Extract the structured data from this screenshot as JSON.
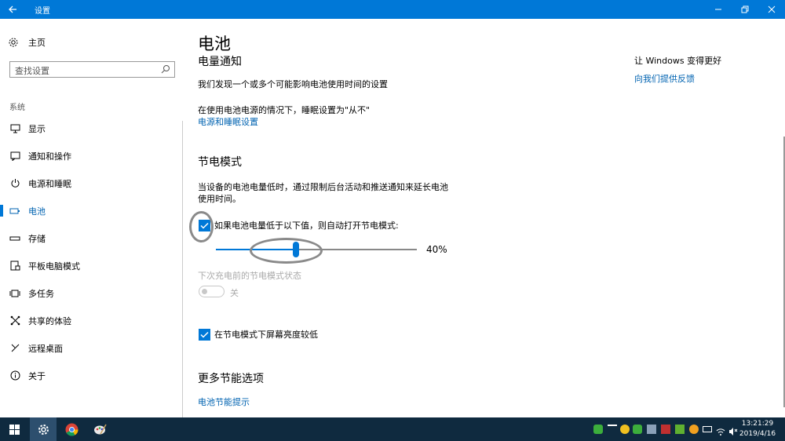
{
  "window": {
    "title": "设置"
  },
  "sidebar": {
    "home_label": "主页",
    "search_placeholder": "查找设置",
    "section_label": "系统",
    "items": [
      {
        "label": "显示",
        "icon": "monitor-icon"
      },
      {
        "label": "通知和操作",
        "icon": "notification-icon"
      },
      {
        "label": "电源和睡眠",
        "icon": "power-icon"
      },
      {
        "label": "电池",
        "icon": "battery-icon",
        "active": true
      },
      {
        "label": "存储",
        "icon": "storage-icon"
      },
      {
        "label": "平板电脑模式",
        "icon": "tablet-icon"
      },
      {
        "label": "多任务",
        "icon": "multitask-icon"
      },
      {
        "label": "共享的体验",
        "icon": "share-icon"
      },
      {
        "label": "远程桌面",
        "icon": "remote-desktop-icon"
      },
      {
        "label": "关于",
        "icon": "info-icon"
      }
    ]
  },
  "main": {
    "title": "电池",
    "notify_heading": "电量通知",
    "notify_text": "我们发现一个或多个可能影响电池使用时间的设置",
    "sleep_text": "在使用电池电源的情况下，睡眠设置为\"从不\"",
    "sleep_link": "电源和睡眠设置",
    "saver_heading": "节电模式",
    "saver_desc_line1": "当设备的电池电量低时，通过限制后台活动和推送通知来延长电池",
    "saver_desc_line2": "使用时间。",
    "auto_checkbox_label": "如果电池电量低于以下值，则自动打开节电模式:",
    "auto_checkbox_checked": true,
    "slider_value_pct": 40,
    "slider_value_label": "40%",
    "next_charge_label": "下次充电前的节电模式状态",
    "toggle_state_label": "关",
    "toggle_on": false,
    "brightness_checkbox_label": "在节电模式下屏幕亮度较低",
    "brightness_checkbox_checked": true,
    "more_heading": "更多节能选项",
    "tips_link": "电池节能提示"
  },
  "right_panel": {
    "heading": "让 Windows 变得更好",
    "feedback_link": "向我们提供反馈"
  },
  "taskbar": {
    "clock_time": "13:21:29",
    "clock_date": "2019/4/16"
  },
  "colors": {
    "accent": "#0078d7",
    "link": "#0063b1",
    "taskbar": "#0f2a3f",
    "annotation": "#8a8a8a"
  }
}
